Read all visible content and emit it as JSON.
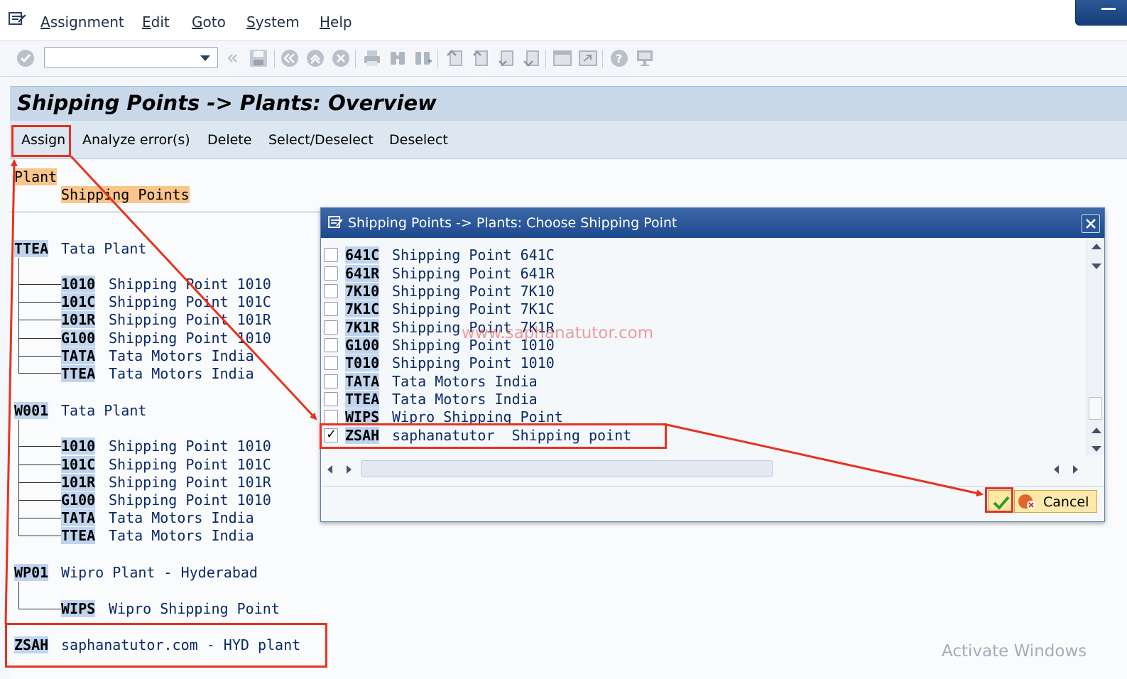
{
  "menubar": {
    "items": [
      "Assignment",
      "Edit",
      "Goto",
      "System",
      "Help"
    ]
  },
  "toolbar": {
    "command_field_value": "",
    "icons": [
      "enter-icon",
      "save-icon",
      "back-icon",
      "exit-icon",
      "cancel-icon",
      "print-icon",
      "find-icon",
      "find-next-icon",
      "first-page-icon",
      "previous-page-icon",
      "next-page-icon",
      "last-page-icon",
      "create-session-icon",
      "shortcut-icon",
      "help-icon",
      "layout-icon"
    ]
  },
  "page": {
    "title": "Shipping Points -> Plants: Overview"
  },
  "app_toolbar": {
    "buttons": [
      "Assign",
      "Analyze error(s)",
      "Delete",
      "Select/Deselect",
      "Deselect"
    ]
  },
  "tree": {
    "header_plant": "Plant",
    "header_shipping": "Shipping Points",
    "plants": [
      {
        "code": "TTEA",
        "name": "Tata Plant",
        "children": [
          {
            "code": "1010",
            "name": "Shipping Point 1010"
          },
          {
            "code": "101C",
            "name": "Shipping Point 101C"
          },
          {
            "code": "101R",
            "name": "Shipping Point 101R"
          },
          {
            "code": "G100",
            "name": "Shipping Point 1010"
          },
          {
            "code": "TATA",
            "name": "Tata Motors India"
          },
          {
            "code": "TTEA",
            "name": "Tata Motors India"
          }
        ]
      },
      {
        "code": "W001",
        "name": "Tata Plant",
        "children": [
          {
            "code": "1010",
            "name": "Shipping Point 1010"
          },
          {
            "code": "101C",
            "name": "Shipping Point 101C"
          },
          {
            "code": "101R",
            "name": "Shipping Point 101R"
          },
          {
            "code": "G100",
            "name": "Shipping Point 1010"
          },
          {
            "code": "TATA",
            "name": "Tata Motors India"
          },
          {
            "code": "TTEA",
            "name": "Tata Motors India"
          }
        ]
      },
      {
        "code": "WP01",
        "name": "Wipro Plant - Hyderabad",
        "children": [
          {
            "code": "WIPS",
            "name": "Wipro Shipping Point"
          }
        ]
      },
      {
        "code": "ZSAH",
        "name": "saphanatutor.com - HYD plant",
        "children": []
      }
    ]
  },
  "dialog": {
    "title": "Shipping Points -> Plants: Choose Shipping Point",
    "rows": [
      {
        "code": "641C",
        "name": "Shipping Point 641C",
        "checked": false
      },
      {
        "code": "641R",
        "name": "Shipping Point 641R",
        "checked": false
      },
      {
        "code": "7K10",
        "name": "Shipping Point 7K10",
        "checked": false
      },
      {
        "code": "7K1C",
        "name": "Shipping Point 7K1C",
        "checked": false
      },
      {
        "code": "7K1R",
        "name": "Shipping Point 7K1R",
        "checked": false
      },
      {
        "code": "G100",
        "name": "Shipping Point 1010",
        "checked": false
      },
      {
        "code": "T010",
        "name": "Shipping Point 1010",
        "checked": false
      },
      {
        "code": "TATA",
        "name": "Tata Motors India",
        "checked": false
      },
      {
        "code": "TTEA",
        "name": "Tata Motors India",
        "checked": false
      },
      {
        "code": "WIPS",
        "name": "Wipro Shipping Point",
        "checked": false
      },
      {
        "code": "ZSAH",
        "name": "saphanatutor  Shipping point",
        "checked": true
      }
    ],
    "cancel_label": "Cancel"
  },
  "watermark": "www.saphanatutor.com",
  "windows_watermark": "Activate Windows",
  "colors": {
    "highlight_red": "#e8321f",
    "title_blue": "#1d4a8e",
    "code_bg": "#c0d4ee",
    "header_orange": "#f9c58a"
  }
}
